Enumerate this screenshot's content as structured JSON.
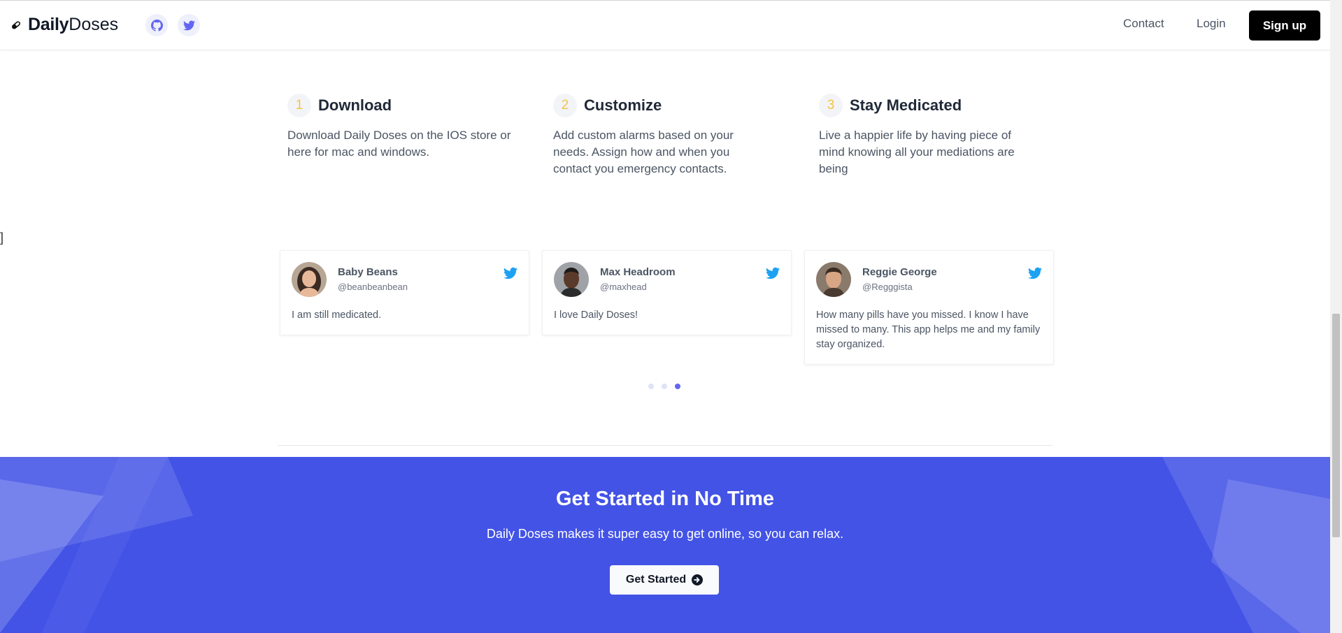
{
  "brand": {
    "bold": "Daily",
    "light": "Doses"
  },
  "header": {
    "social": [
      {
        "icon": "github-icon",
        "color": "#6366f1"
      },
      {
        "icon": "twitter-icon",
        "color": "#6366f1"
      }
    ],
    "nav": {
      "contact": "Contact",
      "login": "Login",
      "signup": "Sign up"
    }
  },
  "steps": [
    {
      "number": "1",
      "title": "Download",
      "text": "Download Daily Doses on the IOS store or here for mac and windows."
    },
    {
      "number": "2",
      "title": "Customize",
      "text": "Add custom alarms based on your needs. Assign how and when you contact you emergency contacts."
    },
    {
      "number": "3",
      "title": "Stay Medicated",
      "text": "Live a happier life by having piece of mind knowing all your mediations are being"
    }
  ],
  "testimonials": [
    {
      "name": "Baby Beans",
      "handle": "@beanbeanbean",
      "text": "I am still medicated."
    },
    {
      "name": "Max Headroom",
      "handle": "@maxhead",
      "text": "I love Daily Doses!"
    },
    {
      "name": "Reggie George",
      "handle": "@Regggista",
      "text": "How many pills have you missed. I know I have missed to many. This app helps me and my family stay organized."
    }
  ],
  "carousel": {
    "active_index": 2,
    "count": 3
  },
  "cta": {
    "title": "Get Started in No Time",
    "subtitle": "Daily Doses makes it super easy to get online, so you can relax.",
    "button": "Get Started"
  },
  "colors": {
    "accent": "#4353e6",
    "step_number": "#f6c344",
    "twitter": "#1da1f2",
    "dot_active": "#6366f1",
    "dot_inactive": "#e0e3f7"
  }
}
